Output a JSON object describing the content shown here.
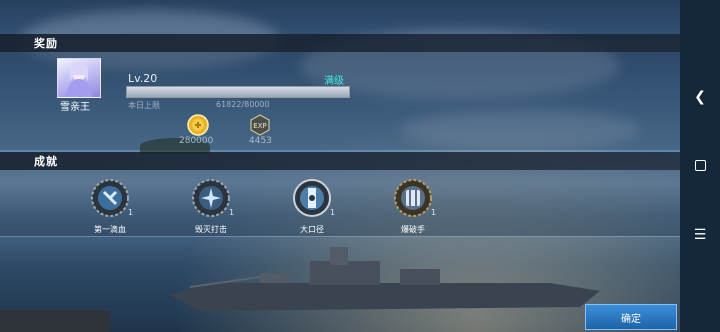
{
  "rewards_section": {
    "title": "奖励",
    "character": {
      "name": "雪亲王",
      "avatar_icon": "character-portrait"
    },
    "level": {
      "label": "Lv.20",
      "status": "满级",
      "progress": 1.0,
      "daily_limit_label": "本日上限",
      "daily_limit_value": "61822/80000"
    },
    "items": [
      {
        "icon": "gold-coin-icon",
        "value": "280000"
      },
      {
        "icon": "exp-icon",
        "value": "4453",
        "icon_text": "EXP"
      }
    ]
  },
  "achievements_section": {
    "title": "成就",
    "items": [
      {
        "name": "第一滴血",
        "count": "1",
        "icon": "first-blood-badge-icon"
      },
      {
        "name": "毁灭打击",
        "count": "1",
        "icon": "devastating-strike-badge-icon"
      },
      {
        "name": "大口径",
        "count": "1",
        "icon": "large-caliber-badge-icon"
      },
      {
        "name": "爆破手",
        "count": "1",
        "icon": "demolition-badge-icon"
      }
    ]
  },
  "actions": {
    "confirm_label": "确定"
  },
  "system_nav": {
    "back_icon": "back-chevron-icon",
    "home_icon": "home-square-icon",
    "menu_icon": "menu-icon"
  },
  "colors": {
    "accent": "#44e8e0",
    "button": "#2a7cc7"
  }
}
